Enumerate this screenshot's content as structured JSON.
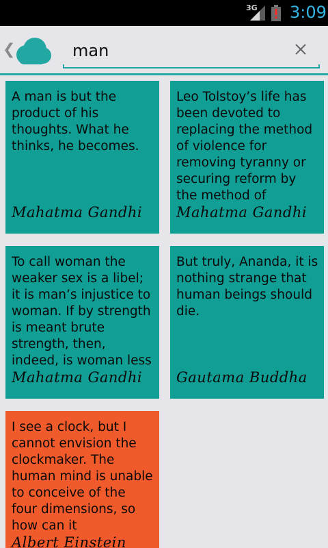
{
  "status_bar": {
    "network": "3G",
    "time": "3:09"
  },
  "search": {
    "value": "man",
    "clear_label": "×"
  },
  "nav": {
    "up_caret": "❮"
  },
  "colors": {
    "teal": "#109e95",
    "orange": "#f15a2b",
    "accent": "#23a7a3",
    "clock": "#33b5e5"
  },
  "quotes": [
    {
      "text": "A man is but the product of his thoughts. What he thinks, he becomes.",
      "author": "Mahatma Gandhi"
    },
    {
      "text": "Leo Tolstoy’s life has been devoted to replacing the method of violence for removing tyranny or securing reform by the method of",
      "author": "Mahatma Gandhi"
    },
    {
      "text": "To call woman the weaker sex is a libel; it is man’s injustice to woman. If by strength is meant brute strength, then, indeed, is woman less brute",
      "author": "Mahatma Gandhi"
    },
    {
      "text": "But truly, Ananda, it is nothing strange that human beings should die.",
      "author": "Gautama Buddha"
    },
    {
      "text": "I see a clock, but I cannot envision the clockmaker. The human mind is unable to conceive of the four dimensions, so how can it",
      "author": "Albert Einstein"
    }
  ]
}
